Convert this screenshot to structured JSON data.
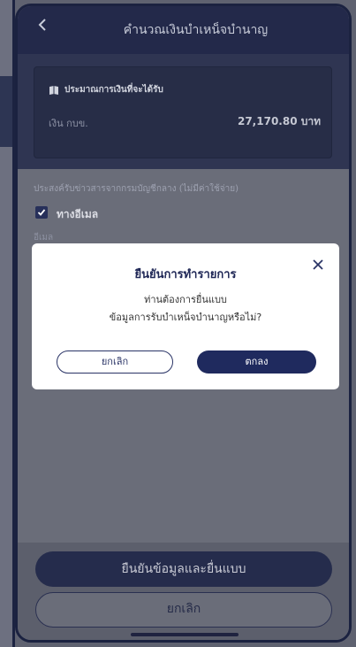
{
  "header": {
    "back_icon": "chevron-left-icon",
    "title": "คำนวณเงินบำเหน็จบำนาญ"
  },
  "summary": {
    "card_title": "ประมาณการเงินที่จะได้รับ",
    "fund_label": "เงิน กบข.",
    "fund_amount": "27,170.80 บาท"
  },
  "consent": {
    "text": "ประสงค์รับข่าวสารจากกรมบัญชีกลาง (ไม่มีค่าใช้จ่าย)",
    "checkbox_label": "ทางอีเมล",
    "checked": true,
    "email_label": "อีเมล"
  },
  "dialog": {
    "title": "ยืนยันการทำรายการ",
    "message_line1": "ท่านต้องการยื่นแบบ",
    "message_line2": "ข้อมูลการรับบำเหน็จบำนาญหรือไม่?",
    "cancel_label": "ยกเลิก",
    "ok_label": "ตกลง"
  },
  "footer": {
    "confirm_label": "ยืนยันข้อมูลและยื่นแบบ",
    "cancel_label": "ยกเลิก"
  },
  "colors": {
    "primary": "#1f2a5e",
    "overlay": "#6a6d79",
    "white": "#ffffff"
  }
}
